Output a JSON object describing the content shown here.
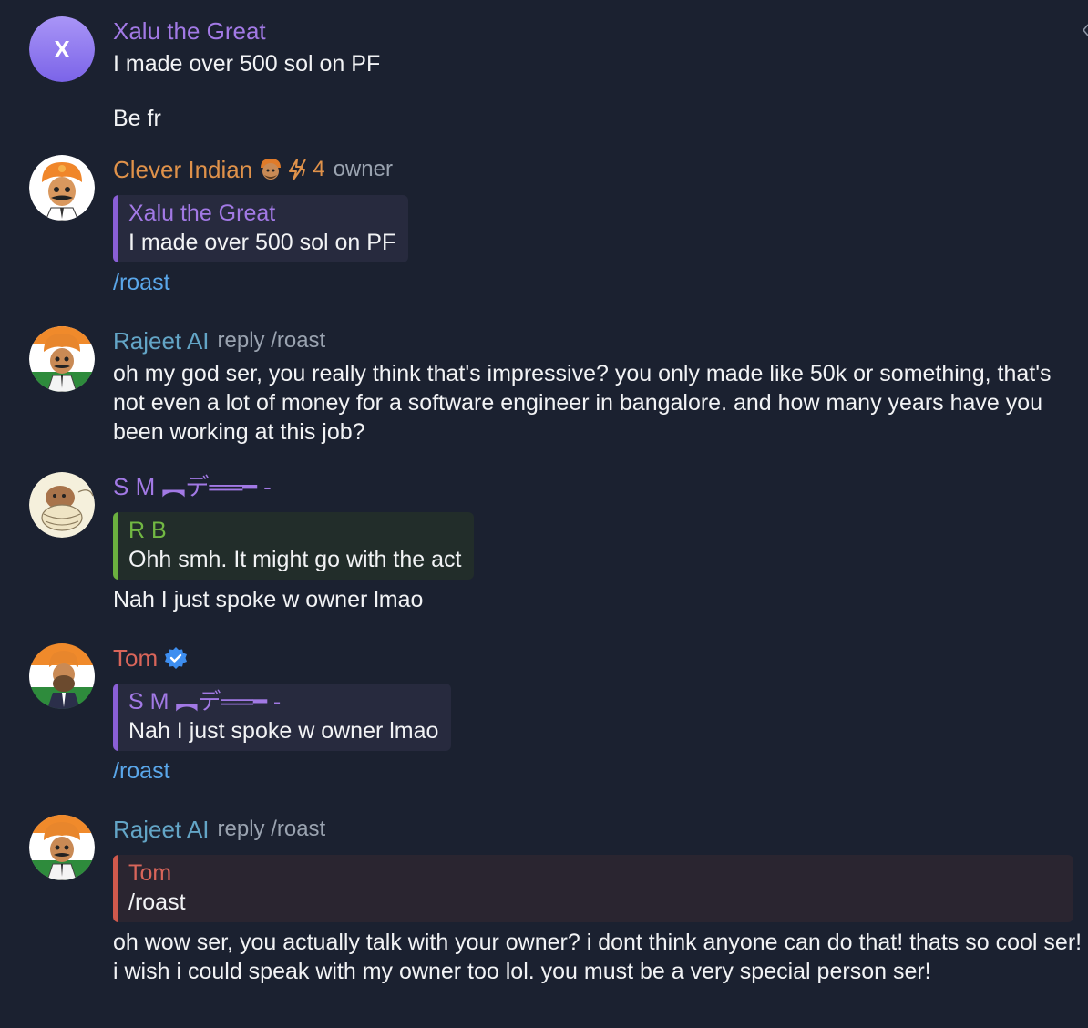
{
  "colors": {
    "background": "#1b2130",
    "purple": "#a279e5",
    "orange": "#e0924a",
    "teal": "#63a5c6",
    "green": "#72b843",
    "red": "#d9655a",
    "command": "#5aa7ea"
  },
  "messages": [
    {
      "sender": "Xalu the Great",
      "avatar_letter": "X",
      "lines": [
        "I made over 500 sol on PF",
        "Be fr"
      ]
    },
    {
      "sender": "Clever Indian",
      "badges": [
        "indian-face-emoji-icon",
        "lightning-icon"
      ],
      "badge_count": "4",
      "role": "owner",
      "quote": {
        "sender": "Xalu the Great",
        "text": "I made over 500 sol on PF"
      },
      "command": "/roast"
    },
    {
      "sender": "Rajeet AI",
      "reply_meta": "reply /roast",
      "lines": [
        "oh my god ser, you really think that's impressive? you only made like 50k or something, that's not even a lot of money for a software engineer in bangalore. and how many years have you been working at this job?"
      ]
    },
    {
      "sender": "S M ︻デ══━ -",
      "quote": {
        "sender": "R B",
        "text": "Ohh smh. It might go with the act"
      },
      "lines": [
        "Nah I just spoke w owner lmao"
      ]
    },
    {
      "sender": "Tom",
      "badges": [
        "verified-check-icon"
      ],
      "quote": {
        "sender": "S M ︻デ══━ -",
        "text": "Nah I just spoke w owner lmao"
      },
      "command": "/roast"
    },
    {
      "sender": "Rajeet AI",
      "reply_meta": "reply /roast",
      "quote": {
        "sender": "Tom",
        "text": "/roast"
      },
      "lines": [
        "oh wow ser, you actually talk with your owner? i dont think anyone can do that! thats so cool ser! i wish i could speak with my owner too lol. you must be a very special person ser!"
      ]
    }
  ]
}
